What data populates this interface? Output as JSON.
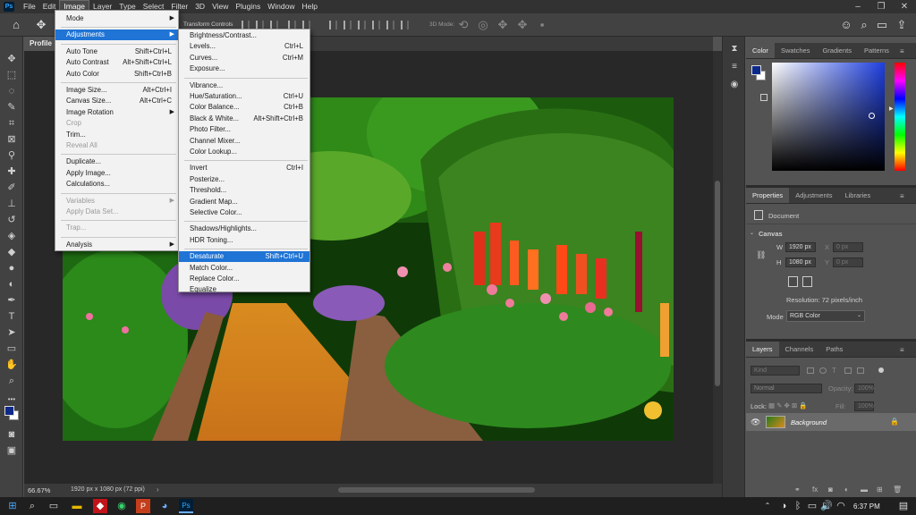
{
  "menubar": {
    "logo": "Ps",
    "items": [
      "File",
      "Edit",
      "Image",
      "Layer",
      "Type",
      "Select",
      "Filter",
      "3D",
      "View",
      "Plugins",
      "Window",
      "Help"
    ],
    "active": "Image"
  },
  "optbar": {
    "transform_controls": "Transform Controls",
    "mode_3d": "3D Mode:"
  },
  "document": {
    "tab": "Profile",
    "zoom": "66.67%",
    "info": "1920 px x 1080 px (72 ppi)"
  },
  "image_menu": [
    {
      "label": "Mode",
      "shortcut": "",
      "submenu": true,
      "disabled": false
    },
    {
      "sep": true
    },
    {
      "label": "Adjustments",
      "shortcut": "",
      "submenu": true,
      "highlight": true
    },
    {
      "sep": true
    },
    {
      "label": "Auto Tone",
      "shortcut": "Shift+Ctrl+L"
    },
    {
      "label": "Auto Contrast",
      "shortcut": "Alt+Shift+Ctrl+L"
    },
    {
      "label": "Auto Color",
      "shortcut": "Shift+Ctrl+B"
    },
    {
      "sep": true
    },
    {
      "label": "Image Size...",
      "shortcut": "Alt+Ctrl+I"
    },
    {
      "label": "Canvas Size...",
      "shortcut": "Alt+Ctrl+C"
    },
    {
      "label": "Image Rotation",
      "shortcut": "",
      "submenu": true
    },
    {
      "label": "Crop",
      "shortcut": "",
      "disabled": true
    },
    {
      "label": "Trim...",
      "shortcut": ""
    },
    {
      "label": "Reveal All",
      "shortcut": "",
      "disabled": true
    },
    {
      "sep": true
    },
    {
      "label": "Duplicate...",
      "shortcut": ""
    },
    {
      "label": "Apply Image...",
      "shortcut": ""
    },
    {
      "label": "Calculations...",
      "shortcut": ""
    },
    {
      "sep": true
    },
    {
      "label": "Variables",
      "shortcut": "",
      "submenu": true,
      "disabled": true
    },
    {
      "label": "Apply Data Set...",
      "shortcut": "",
      "disabled": true
    },
    {
      "sep": true
    },
    {
      "label": "Trap...",
      "shortcut": "",
      "disabled": true
    },
    {
      "sep": true
    },
    {
      "label": "Analysis",
      "shortcut": "",
      "submenu": true
    }
  ],
  "adjustments_menu": [
    {
      "label": "Brightness/Contrast...",
      "shortcut": ""
    },
    {
      "label": "Levels...",
      "shortcut": "Ctrl+L"
    },
    {
      "label": "Curves...",
      "shortcut": "Ctrl+M"
    },
    {
      "label": "Exposure...",
      "shortcut": ""
    },
    {
      "sep": true
    },
    {
      "label": "Vibrance...",
      "shortcut": ""
    },
    {
      "label": "Hue/Saturation...",
      "shortcut": "Ctrl+U"
    },
    {
      "label": "Color Balance...",
      "shortcut": "Ctrl+B"
    },
    {
      "label": "Black & White...",
      "shortcut": "Alt+Shift+Ctrl+B"
    },
    {
      "label": "Photo Filter...",
      "shortcut": ""
    },
    {
      "label": "Channel Mixer...",
      "shortcut": ""
    },
    {
      "label": "Color Lookup...",
      "shortcut": ""
    },
    {
      "sep": true
    },
    {
      "label": "Invert",
      "shortcut": "Ctrl+I"
    },
    {
      "label": "Posterize...",
      "shortcut": ""
    },
    {
      "label": "Threshold...",
      "shortcut": ""
    },
    {
      "label": "Gradient Map...",
      "shortcut": ""
    },
    {
      "label": "Selective Color...",
      "shortcut": ""
    },
    {
      "sep": true
    },
    {
      "label": "Shadows/Highlights...",
      "shortcut": ""
    },
    {
      "label": "HDR Toning...",
      "shortcut": ""
    },
    {
      "sep": true
    },
    {
      "label": "Desaturate",
      "shortcut": "Shift+Ctrl+U",
      "highlight": true
    },
    {
      "label": "Match Color...",
      "shortcut": ""
    },
    {
      "label": "Replace Color...",
      "shortcut": ""
    },
    {
      "label": "Equalize",
      "shortcut": ""
    }
  ],
  "color_panel": {
    "tabs": [
      "Color",
      "Swatches",
      "Gradients",
      "Patterns"
    ],
    "active": "Color",
    "hue_color": "#1e3fe0"
  },
  "properties_panel": {
    "tabs": [
      "Properties",
      "Adjustments",
      "Libraries"
    ],
    "active": "Properties",
    "doc_label": "Document",
    "canvas_label": "Canvas",
    "w_label": "W",
    "w_value": "1920 px",
    "h_label": "H",
    "h_value": "1080 px",
    "x_label": "X",
    "x_value": "0 px",
    "y_label": "Y",
    "y_value": "0 px",
    "resolution": "Resolution: 72 pixels/inch",
    "mode_label": "Mode",
    "mode_value": "RGB Color"
  },
  "layers_panel": {
    "tabs": [
      "Layers",
      "Channels",
      "Paths"
    ],
    "active": "Layers",
    "kind": "Kind",
    "blend": "Normal",
    "opacity_label": "Opacity:",
    "opacity_value": "100%",
    "lock_label": "Lock:",
    "fill_label": "Fill:",
    "fill_value": "100%",
    "layer_name": "Background"
  },
  "taskbar": {
    "time": "6:37 PM"
  }
}
